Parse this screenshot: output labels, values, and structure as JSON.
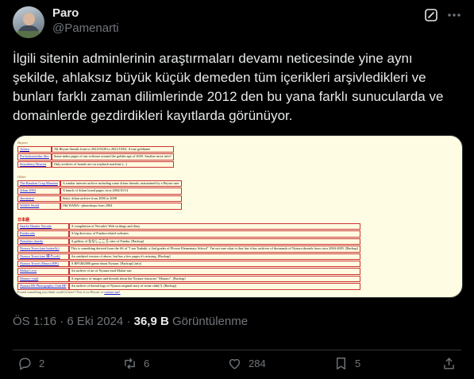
{
  "author": {
    "display_name": "Paro",
    "handle": "@Pamenarti"
  },
  "tweet": {
    "text": "İlgili sitenin adminlerinin araştırmaları devamı neticesinde yine aynı şekilde, ahlaksız büyük küçük demeden tüm içerikleri arşivledikleri ve bunları farklı zaman dilimlerinde 2012 den bu yana farklı sunucularda ve domainlerde gezdirdikleri kayıtlarda görünüyor."
  },
  "media": {
    "section1_title": "Hayari",
    "section1_rows": [
      {
        "name": "Arhiva",
        "desc": "All Heyuri threads from to 2021/03/28 to 2021/10/02. A true goldmine"
      },
      {
        "name": "Pre-kokoroteshu files",
        "desc": "Some index pages of our software around the golden age of 2020. Another more info?"
      },
      {
        "name": "Smoothery Heaven",
        "desc": "Only archives of boards are on wayback machine (...)"
      }
    ],
    "section2_title": "Other",
    "section2_rows": [
      {
        "name": "The Random Crap Museum",
        "desc": "A similar internet archive including some 4chan threads, maintained by a Heyuri user"
      },
      {
        "name": "4chan 2004",
        "desc": "A bunch of 4chan board pages circa 2004/10/14"
      },
      {
        "name": "4nonsense",
        "desc": "Static 4chan archive from 2006 to 2008"
      },
      {
        "name": "WAHA World",
        "desc": "Old WAHA~ photoshops from 2004"
      }
    ],
    "section3_title": "日本語",
    "section3_rows": [
      {
        "name": "Saarbo Hauder Nevada",
        "desc": "A compilation of Nevada's Web writings and diary"
      },
      {
        "name": "Futaba ado",
        "desc": "A big directory of Futaba-related websites"
      },
      {
        "name": "Nonuhiro daredo",
        "desc": "A gallery of ななしこころ sites of Futaba. [Backup]"
      },
      {
        "name": "Nyuura Town (one butterfly)",
        "desc": "This is something derived from the SS of \"I am Tsubaki, a 2nd grader of Flower Elementary School\". I'm not sure what is that, but it has archives of thousands of Nyuura threads from circa 2004-2005. [Backup]"
      },
      {
        "name": "Nyuura Town (one 蝶々web)",
        "desc": "An outdated version of above, but has a few pages it's missing. [Backup]"
      },
      {
        "name": "Nyuura Town's Mascot RPG",
        "desc": "A RPGM2000 game about Nyuura. [Backup] [info]"
      },
      {
        "name": "Mokai Love",
        "desc": "An archive of art of Nyuura mod Mokai-san"
      },
      {
        "name": "Monaro vault",
        "desc": "A repository of images and threads about the Nyuura character \"Monaro\". [Backup]"
      },
      {
        "name": "Nyuura HS Photography Club HP",
        "desc": "An archive of thread logs of Nyuura original story of some club(?). [Backup]"
      }
    ],
    "footer_text": "Found something you think could fit here? Post it on Heyuri or",
    "footer_link": "contact me!"
  },
  "meta": {
    "time": "ÖS 1:16",
    "sep1": "·",
    "date": "6 Eki 2024",
    "sep2": "·",
    "views": "36,9 B",
    "views_label": "Görüntülenme"
  },
  "actions": {
    "replies": "2",
    "reposts": "6",
    "likes": "284",
    "bookmarks": "5"
  },
  "icons": [
    "grok-icon",
    "more-icon",
    "reply-icon",
    "repost-icon",
    "like-icon",
    "bookmark-icon",
    "share-icon"
  ]
}
